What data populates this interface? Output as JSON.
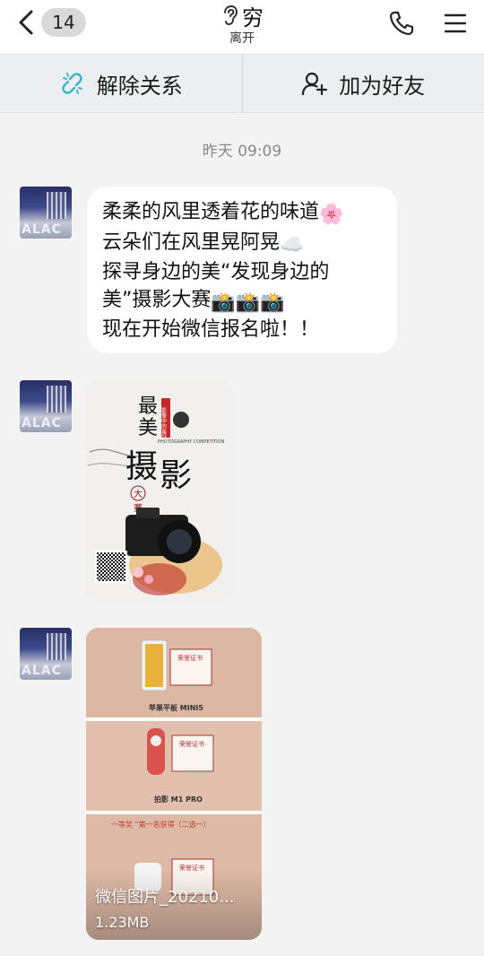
{
  "header": {
    "unread_count": "14",
    "name": "穷",
    "status": "离开"
  },
  "actions": {
    "unbind_label": "解除关系",
    "add_friend_label": "加为好友"
  },
  "chat": {
    "timestamp": "昨天 09:09",
    "avatar_text": "ALAC",
    "text_message": {
      "lines": [
        "柔柔的风里透着花的味道",
        "云朵们在风里晃阿晃",
        "探寻身边的美“发现身边的",
        "美”摄影大赛",
        "现在开始微信报名啦！！"
      ],
      "emojis": [
        "🌸",
        "☁️",
        "📸📸📸"
      ]
    },
    "poster": {
      "title_line1": "最",
      "title_line2": "美",
      "big1": "摄",
      "big2": "影",
      "seal1": "大",
      "seal2": "赛",
      "side_text": "影像中的美好",
      "en_text": "PHOTOGRAPHY COMPETITION"
    },
    "file_image": {
      "prize1": "苹果平板 MINI5",
      "prize2": "拍影 M1 PRO",
      "banner": "一等奖 “第一名获得（二选一）",
      "cert": "荣誉证书",
      "filename": "微信图片_20210...",
      "filesize": "1.23MB"
    }
  },
  "colors": {
    "background": "#f3f3f3",
    "bubble": "#ffffff",
    "link_icon": "#3bb6c8"
  }
}
